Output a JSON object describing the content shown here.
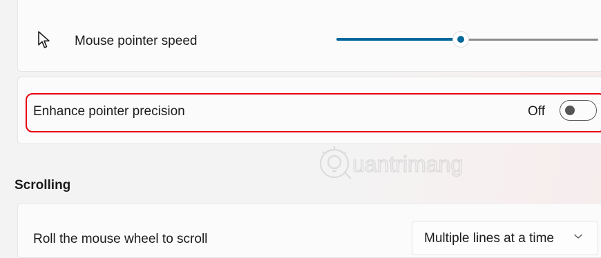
{
  "mouse_pointer_speed": {
    "label": "Mouse pointer speed",
    "icon": "mouse-pointer-icon",
    "slider_value_percent": 47,
    "accent_color": "#00679b"
  },
  "enhance_pointer_precision": {
    "label": "Enhance pointer precision",
    "state_label": "Off",
    "toggle_on": false,
    "highlight_color": "#e8000d"
  },
  "scrolling": {
    "heading": "Scrolling",
    "roll_wheel": {
      "label": "Roll the mouse wheel to scroll",
      "selected": "Multiple lines at a time"
    }
  },
  "watermark": {
    "text": "uantrimang",
    "icon": "bulb-q-logo-icon"
  }
}
